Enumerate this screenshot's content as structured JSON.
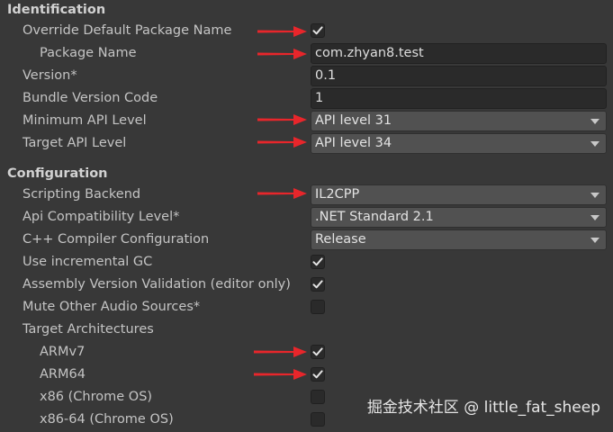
{
  "identification": {
    "header": "Identification",
    "override_default_package_name": {
      "label": "Override Default Package Name",
      "checked": true
    },
    "package_name": {
      "label": "Package Name",
      "value": "com.zhyan8.test"
    },
    "version": {
      "label": "Version*",
      "value": "0.1"
    },
    "bundle_version_code": {
      "label": "Bundle Version Code",
      "value": "1"
    },
    "minimum_api_level": {
      "label": "Minimum API Level",
      "value": "API level 31"
    },
    "target_api_level": {
      "label": "Target API Level",
      "value": "API level 34"
    }
  },
  "configuration": {
    "header": "Configuration",
    "scripting_backend": {
      "label": "Scripting Backend",
      "value": "IL2CPP"
    },
    "api_compatibility_level": {
      "label": "Api Compatibility Level*",
      "value": ".NET Standard 2.1"
    },
    "cpp_compiler_configuration": {
      "label": "C++ Compiler Configuration",
      "value": "Release"
    },
    "use_incremental_gc": {
      "label": "Use incremental GC",
      "checked": true
    },
    "assembly_version_validation": {
      "label": "Assembly Version Validation (editor only)",
      "checked": true
    },
    "mute_other_audio_sources": {
      "label": "Mute Other Audio Sources*",
      "checked": false
    },
    "target_architectures": {
      "label": "Target Architectures",
      "armv7": {
        "label": "ARMv7",
        "checked": true
      },
      "arm64": {
        "label": "ARM64",
        "checked": true
      },
      "x86": {
        "label": "x86 (Chrome OS)",
        "checked": false
      },
      "x86_64": {
        "label": "x86-64 (Chrome OS)",
        "checked": false
      }
    }
  },
  "watermark": "掘金技术社区 @ little_fat_sheep",
  "colors": {
    "background": "#383838",
    "field_background": "#2a2a2a",
    "dropdown_background": "#515151",
    "annotation_arrow": "#e8262b"
  }
}
